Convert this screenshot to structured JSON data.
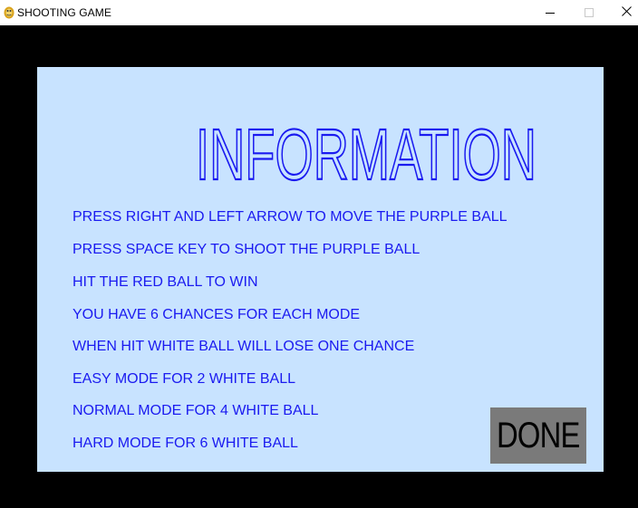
{
  "window": {
    "title": "SHOOTING GAME"
  },
  "info_panel": {
    "heading": "INFORMATION",
    "lines": [
      "PRESS RIGHT AND LEFT ARROW TO MOVE THE PURPLE BALL",
      "PRESS SPACE KEY TO SHOOT THE PURPLE BALL",
      "HIT THE RED BALL TO WIN",
      "YOU HAVE 6 CHANCES FOR EACH MODE",
      "WHEN HIT WHITE BALL WILL LOSE ONE CHANCE",
      "EASY MODE FOR 2 WHITE BALL",
      "NORMAL MODE FOR 4 WHITE BALL",
      "HARD MODE FOR 6 WHITE BALL"
    ],
    "done_label": "DONE"
  },
  "colors": {
    "panel_bg": "#c8e3ff",
    "text": "#1a1af0",
    "button_bg": "#7a7a7a",
    "backdrop": "#000000"
  },
  "icons": {
    "app": "pygame-snake-icon",
    "minimize": "minimize-icon",
    "maximize": "maximize-icon",
    "close": "close-icon"
  }
}
